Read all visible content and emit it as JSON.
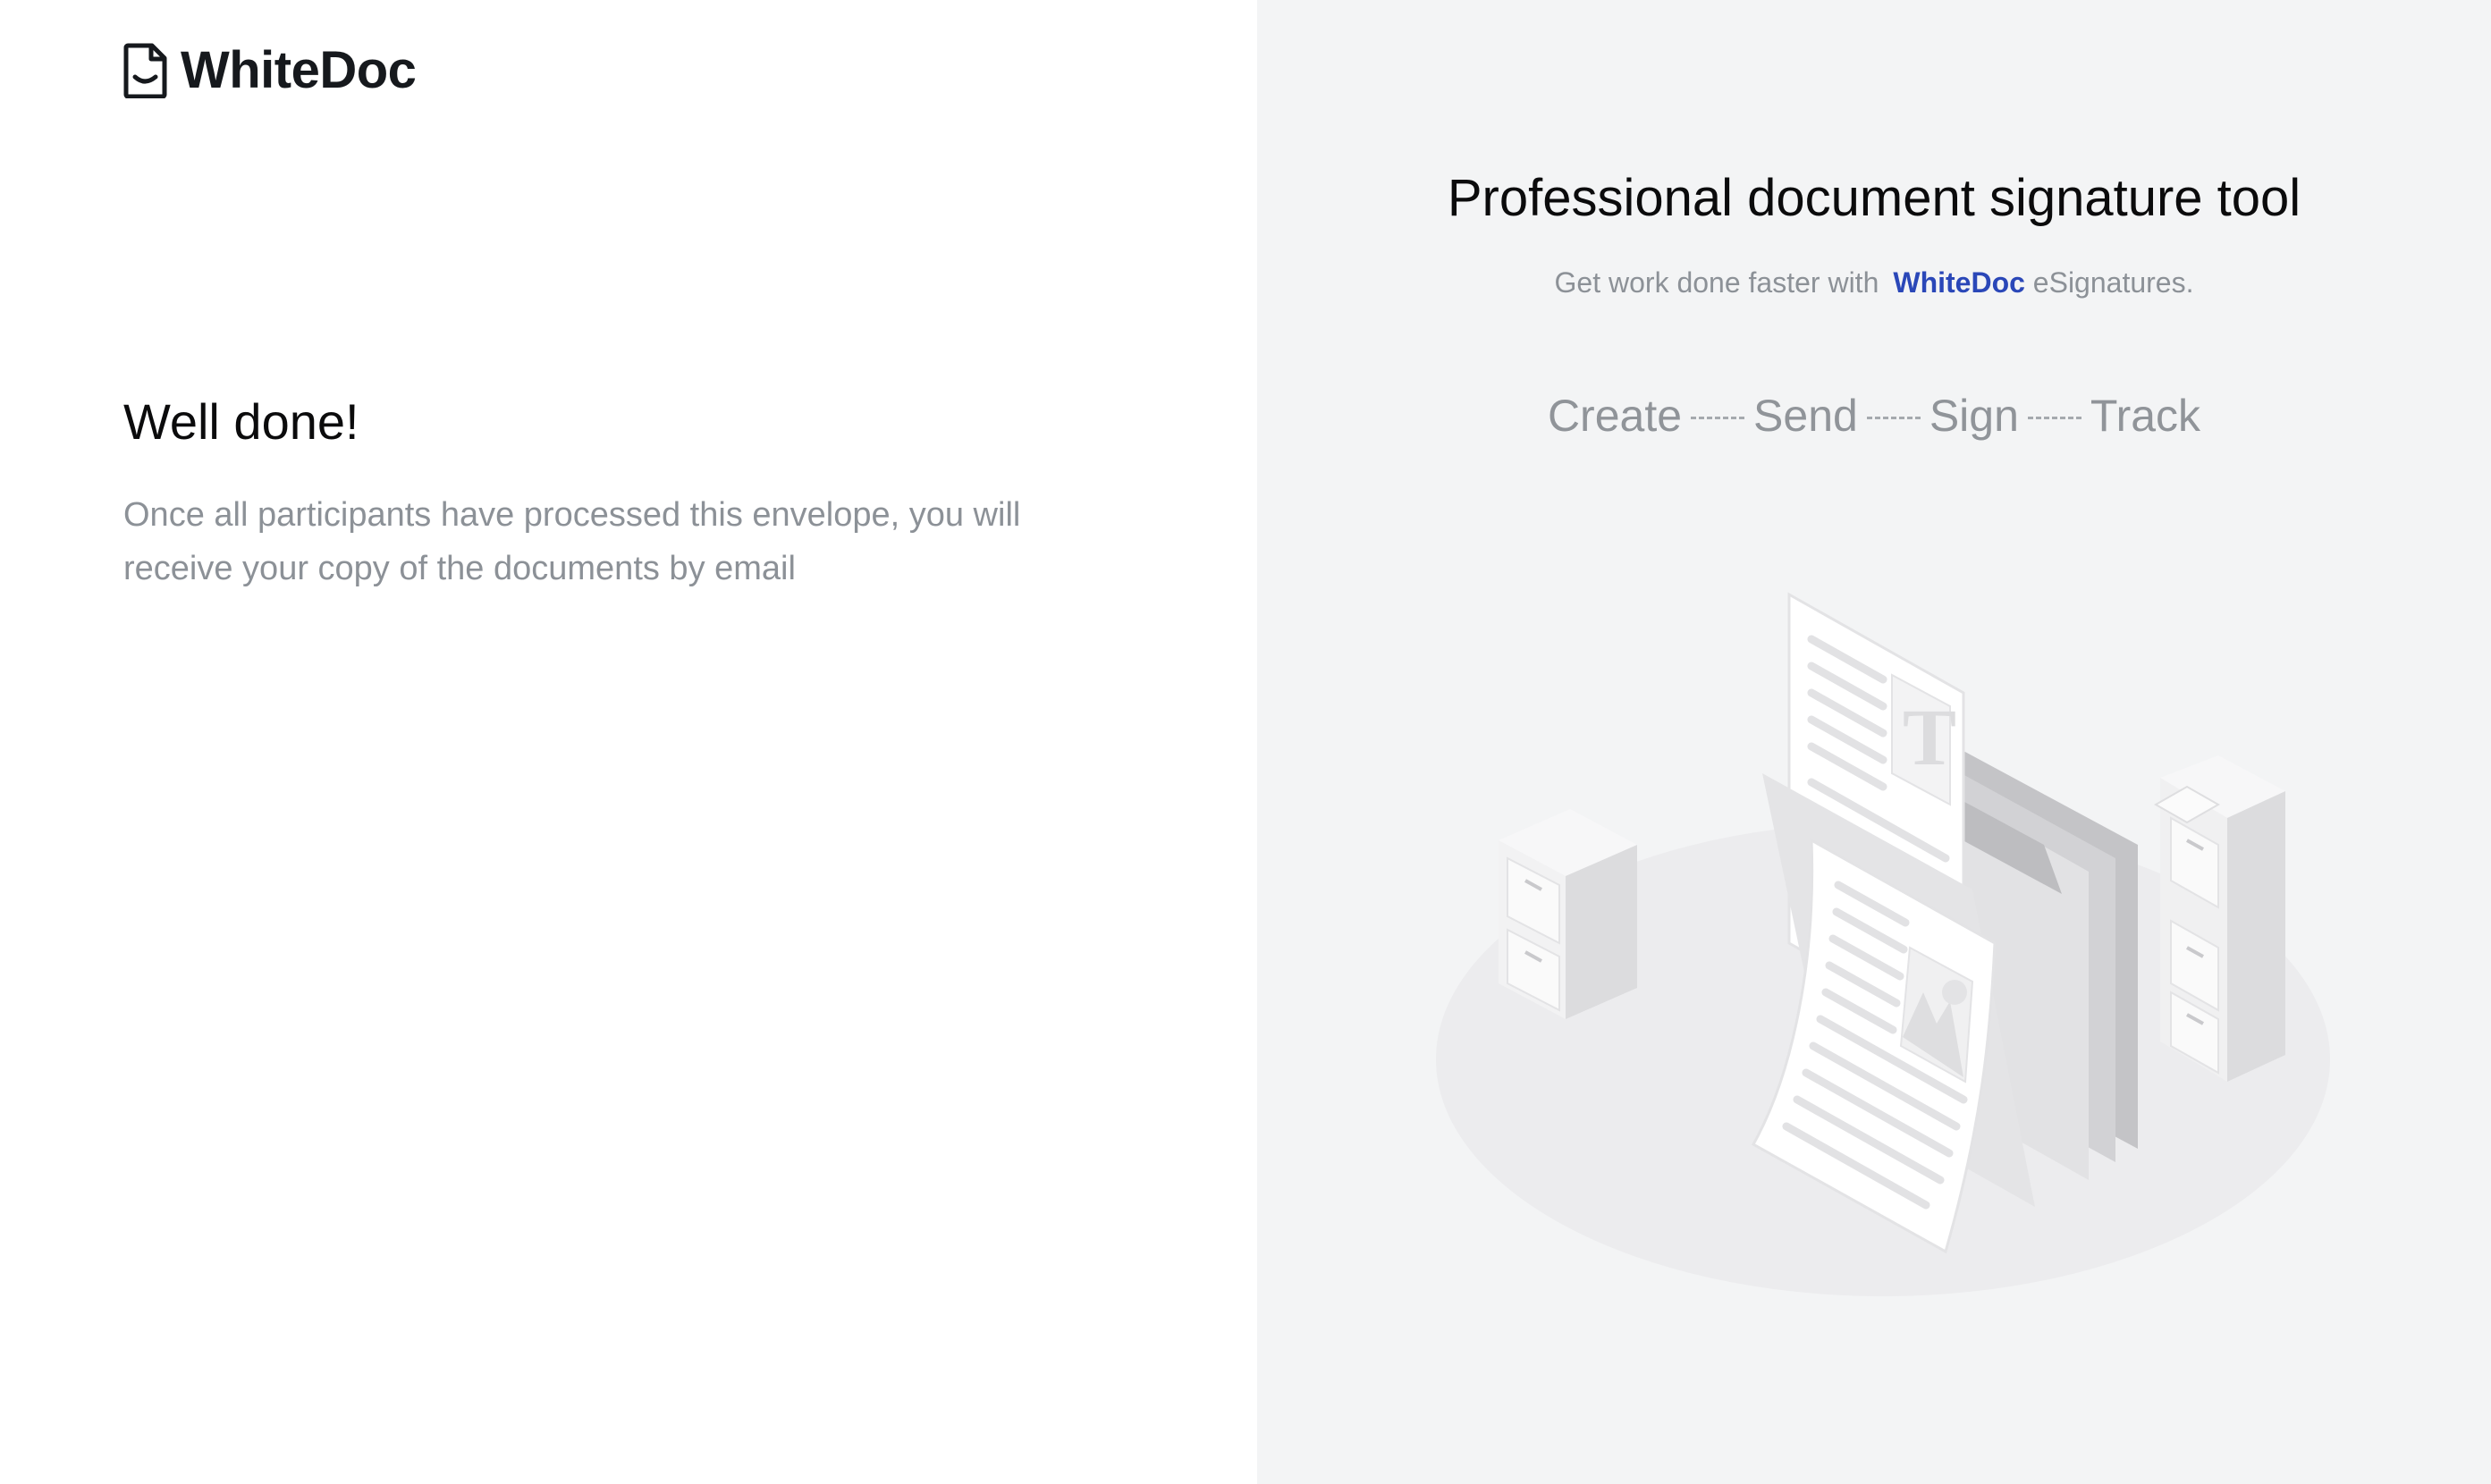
{
  "brand": {
    "name": "WhiteDoc",
    "icon": "document-smile-icon"
  },
  "left": {
    "headline": "Well done!",
    "message": "Once all participants have processed this envelope, you will receive your copy of the documents by email"
  },
  "right": {
    "title": "Professional document signature tool",
    "subtitle_prefix": "Get work done faster with",
    "subtitle_brand": "WhiteDoc",
    "subtitle_suffix": " eSignatures.",
    "steps": [
      "Create",
      "Send",
      "Sign",
      "Track"
    ],
    "illustration": "isometric-documents-illustration"
  },
  "colors": {
    "left_background": "#ffffff",
    "right_background": "#f3f4f5",
    "brand_accent": "#2a47b8",
    "muted_text": "#8c9197",
    "heading_text": "#0b0b0c"
  }
}
